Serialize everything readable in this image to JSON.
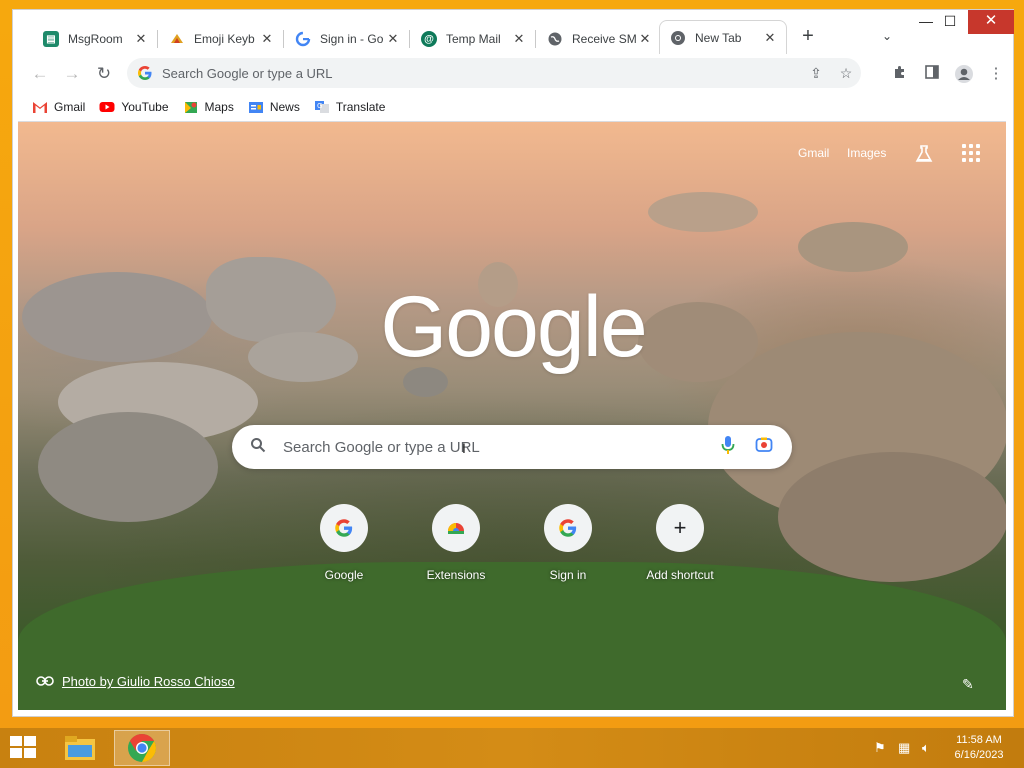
{
  "window": {
    "tabs": [
      {
        "title": "MsgRoom",
        "favicon": "msgroom-icon",
        "color": "#1e8a6a"
      },
      {
        "title": "Emoji Keyb",
        "favicon": "emoji-keyboard-icon",
        "color": "#e0a020"
      },
      {
        "title": "Sign in - Go",
        "favicon": "google-g-icon",
        "color": "#4285f4"
      },
      {
        "title": "Temp Mail",
        "favicon": "temp-mail-icon",
        "color": "#0f7a5a"
      },
      {
        "title": "Receive SM",
        "favicon": "globe-icon",
        "color": "#5f6368"
      },
      {
        "title": "New Tab",
        "favicon": "chrome-icon",
        "color": "#5f6368"
      }
    ],
    "new_tab_symbol": "+",
    "tab_search_symbol": "⌄",
    "controls": {
      "minimize": "—",
      "maximize": "☐",
      "close": "✕"
    }
  },
  "toolbar": {
    "back": "←",
    "forward": "→",
    "reload": "↻",
    "omnibox_placeholder": "Search Google or type a URL"
  },
  "bookmarks": [
    {
      "label": "Gmail",
      "icon": "gmail-icon",
      "color": "#ea4335"
    },
    {
      "label": "YouTube",
      "icon": "youtube-icon",
      "color": "#ff0000"
    },
    {
      "label": "Maps",
      "icon": "maps-icon",
      "color": "#34a853"
    },
    {
      "label": "News",
      "icon": "news-icon",
      "color": "#4285f4"
    },
    {
      "label": "Translate",
      "icon": "translate-icon",
      "color": "#4285f4"
    }
  ],
  "ntp": {
    "top_links": {
      "gmail": "Gmail",
      "images": "Images"
    },
    "logo": "Google",
    "search_placeholder": "Search Google or type a URL",
    "shortcuts": [
      {
        "label": "Google",
        "icon": "google-g-icon"
      },
      {
        "label": "Extensions",
        "icon": "chrome-web-store-icon"
      },
      {
        "label": "Sign in",
        "icon": "google-g-icon"
      },
      {
        "label": "Add shortcut",
        "icon": "plus-icon",
        "symbol": "+"
      }
    ],
    "photo_credit": "Photo by Giulio Rosso Chioso"
  },
  "taskbar": {
    "time": "11:58 AM",
    "date": "6/16/2023"
  }
}
